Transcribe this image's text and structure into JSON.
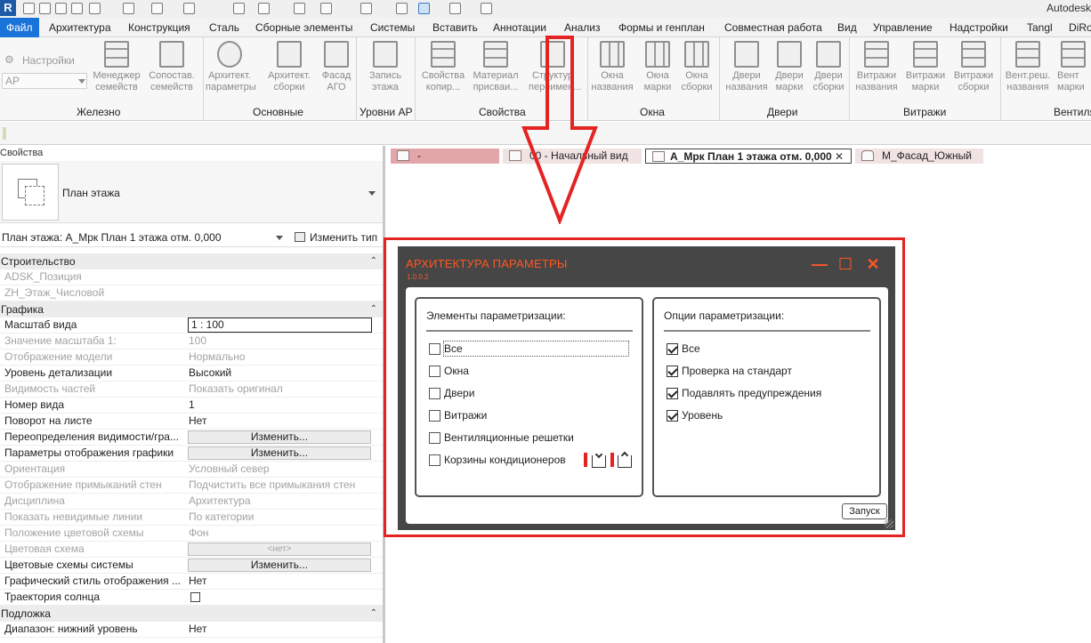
{
  "app": {
    "title": "Autodesk Re",
    "logo_letter": "R"
  },
  "menu": {
    "tabs": [
      "Файл",
      "Архитектура",
      "Конструкция",
      "Сталь",
      "Сборные элементы",
      "Системы",
      "Вставить",
      "Аннотации",
      "Анализ",
      "Формы и генплан",
      "Совместная работа",
      "Вид",
      "Управление",
      "Надстройки",
      "Tangl",
      "DiRo"
    ]
  },
  "ribbon": {
    "settings_label": "Настройки",
    "discipline_select": "АР",
    "buttons": {
      "family_manager": "Менеджер семейств",
      "family_compare": "Сопостав. семейств",
      "arch_params": "Архитект. параметры",
      "arch_assemblies": "Архитект. сборки",
      "facade_ago": "Фасад АГО",
      "write_level": "Запись этажа",
      "copy_props": "Свойства копир...",
      "material_assign": "Материал присваи...",
      "structure_rename": "Структур переимен...",
      "window_names": "Окна названия",
      "window_marks": "Окна марки",
      "window_assemblies": "Окна сборки",
      "door_names": "Двери названия",
      "door_marks": "Двери марки",
      "door_assemblies": "Двери сборки",
      "curtain_names": "Витражи названия",
      "curtain_marks": "Витражи марки",
      "curtain_assemblies": "Витражи сборки",
      "vent_names": "Вент.реш. названия",
      "vent_marks": "Вент марки"
    },
    "panels": [
      "Железно",
      "Основные",
      "Уровни АР",
      "Свойства",
      "Окна",
      "Двери",
      "Витражи",
      "Вентиля"
    ]
  },
  "properties": {
    "panel_title": "Свойства",
    "type_name": "План этажа",
    "selector_value": "План этажа: А_Мрк План 1 этажа отм. 0,000",
    "edit_type_label": "Изменить тип",
    "groups": {
      "construction": "Строительство",
      "graphics": "Графика",
      "underlay": "Подложка"
    },
    "toggle_glyph": "⌃",
    "rows": {
      "adsk_position": {
        "key": "ADSK_Позиция",
        "value": ""
      },
      "zh_floor_number": {
        "key": "ZH_Этаж_Числовой",
        "value": ""
      },
      "view_scale": {
        "key": "Масштаб вида",
        "value": "1 : 100"
      },
      "scale_value": {
        "key": "Значение масштаба    1:",
        "value": "100"
      },
      "model_display": {
        "key": "Отображение модели",
        "value": "Нормально"
      },
      "detail_level": {
        "key": "Уровень детализации",
        "value": "Высокий"
      },
      "parts_visibility": {
        "key": "Видимость частей",
        "value": "Показать оригинал"
      },
      "view_number": {
        "key": "Номер вида",
        "value": "1"
      },
      "rotation_on_sheet": {
        "key": "Поворот на листе",
        "value": "Нет"
      },
      "visibility_overrides": {
        "key": "Переопределения видимости/гра...",
        "value": "Изменить..."
      },
      "graphic_display": {
        "key": "Параметры отображения графики",
        "value": "Изменить..."
      },
      "orientation": {
        "key": "Ориентация",
        "value": "Условный север"
      },
      "wall_joins": {
        "key": "Отображение примыканий стен",
        "value": "Подчистить все примыкания стен"
      },
      "discipline": {
        "key": "Дисциплина",
        "value": "Архитектура"
      },
      "hidden_lines": {
        "key": "Показать невидимые линии",
        "value": "По категории"
      },
      "color_scheme_location": {
        "key": "Положение цветовой схемы",
        "value": "Фон"
      },
      "color_scheme": {
        "key": "Цветовая схема",
        "value": "<нет>"
      },
      "system_color_schemes": {
        "key": "Цветовые схемы системы",
        "value": "Изменить..."
      },
      "graphic_style": {
        "key": "Графический стиль отображения ...",
        "value": "Нет"
      },
      "sun_path": {
        "key": "Траектория солнца",
        "value": ""
      },
      "range_bottom": {
        "key": "Диапазон: нижний уровень",
        "value": "Нет"
      }
    }
  },
  "view_tabs": [
    {
      "label": "-",
      "color": "#e2a5a8"
    },
    {
      "label": "00 - Начальный вид",
      "color": "#f1e3e3"
    },
    {
      "label": "А_Мрк План 1 этажа отм. 0,000",
      "color": "#ffffff"
    },
    {
      "label": "М_Фасад_Южный",
      "color": "#f1e3e3"
    }
  ],
  "view_tab_close": "✕",
  "dialog": {
    "title": "АРХИТЕКТУРА ПАРАМЕТРЫ",
    "version": "1.0.0.2",
    "accent_color": "#ff5722",
    "controls": {
      "minimize": "—",
      "maximize": "☐",
      "close": "✕"
    },
    "elements_group": {
      "title": "Элементы параметризации:",
      "items": [
        {
          "label": "Все",
          "checked": false
        },
        {
          "label": "Окна",
          "checked": false
        },
        {
          "label": "Двери",
          "checked": false
        },
        {
          "label": "Витражи",
          "checked": false
        },
        {
          "label": "Вентиляционные решетки",
          "checked": false
        },
        {
          "label": "Корзины кондиционеров",
          "checked": false
        }
      ]
    },
    "options_group": {
      "title": "Опции параметризации:",
      "items": [
        {
          "label": "Все",
          "checked": true
        },
        {
          "label": "Проверка на стандарт",
          "checked": true
        },
        {
          "label": "Подавлять предупреждения",
          "checked": true
        },
        {
          "label": "Уровень",
          "checked": true
        }
      ]
    },
    "run_label": "Запуск"
  },
  "highlight_color": "#e42323"
}
